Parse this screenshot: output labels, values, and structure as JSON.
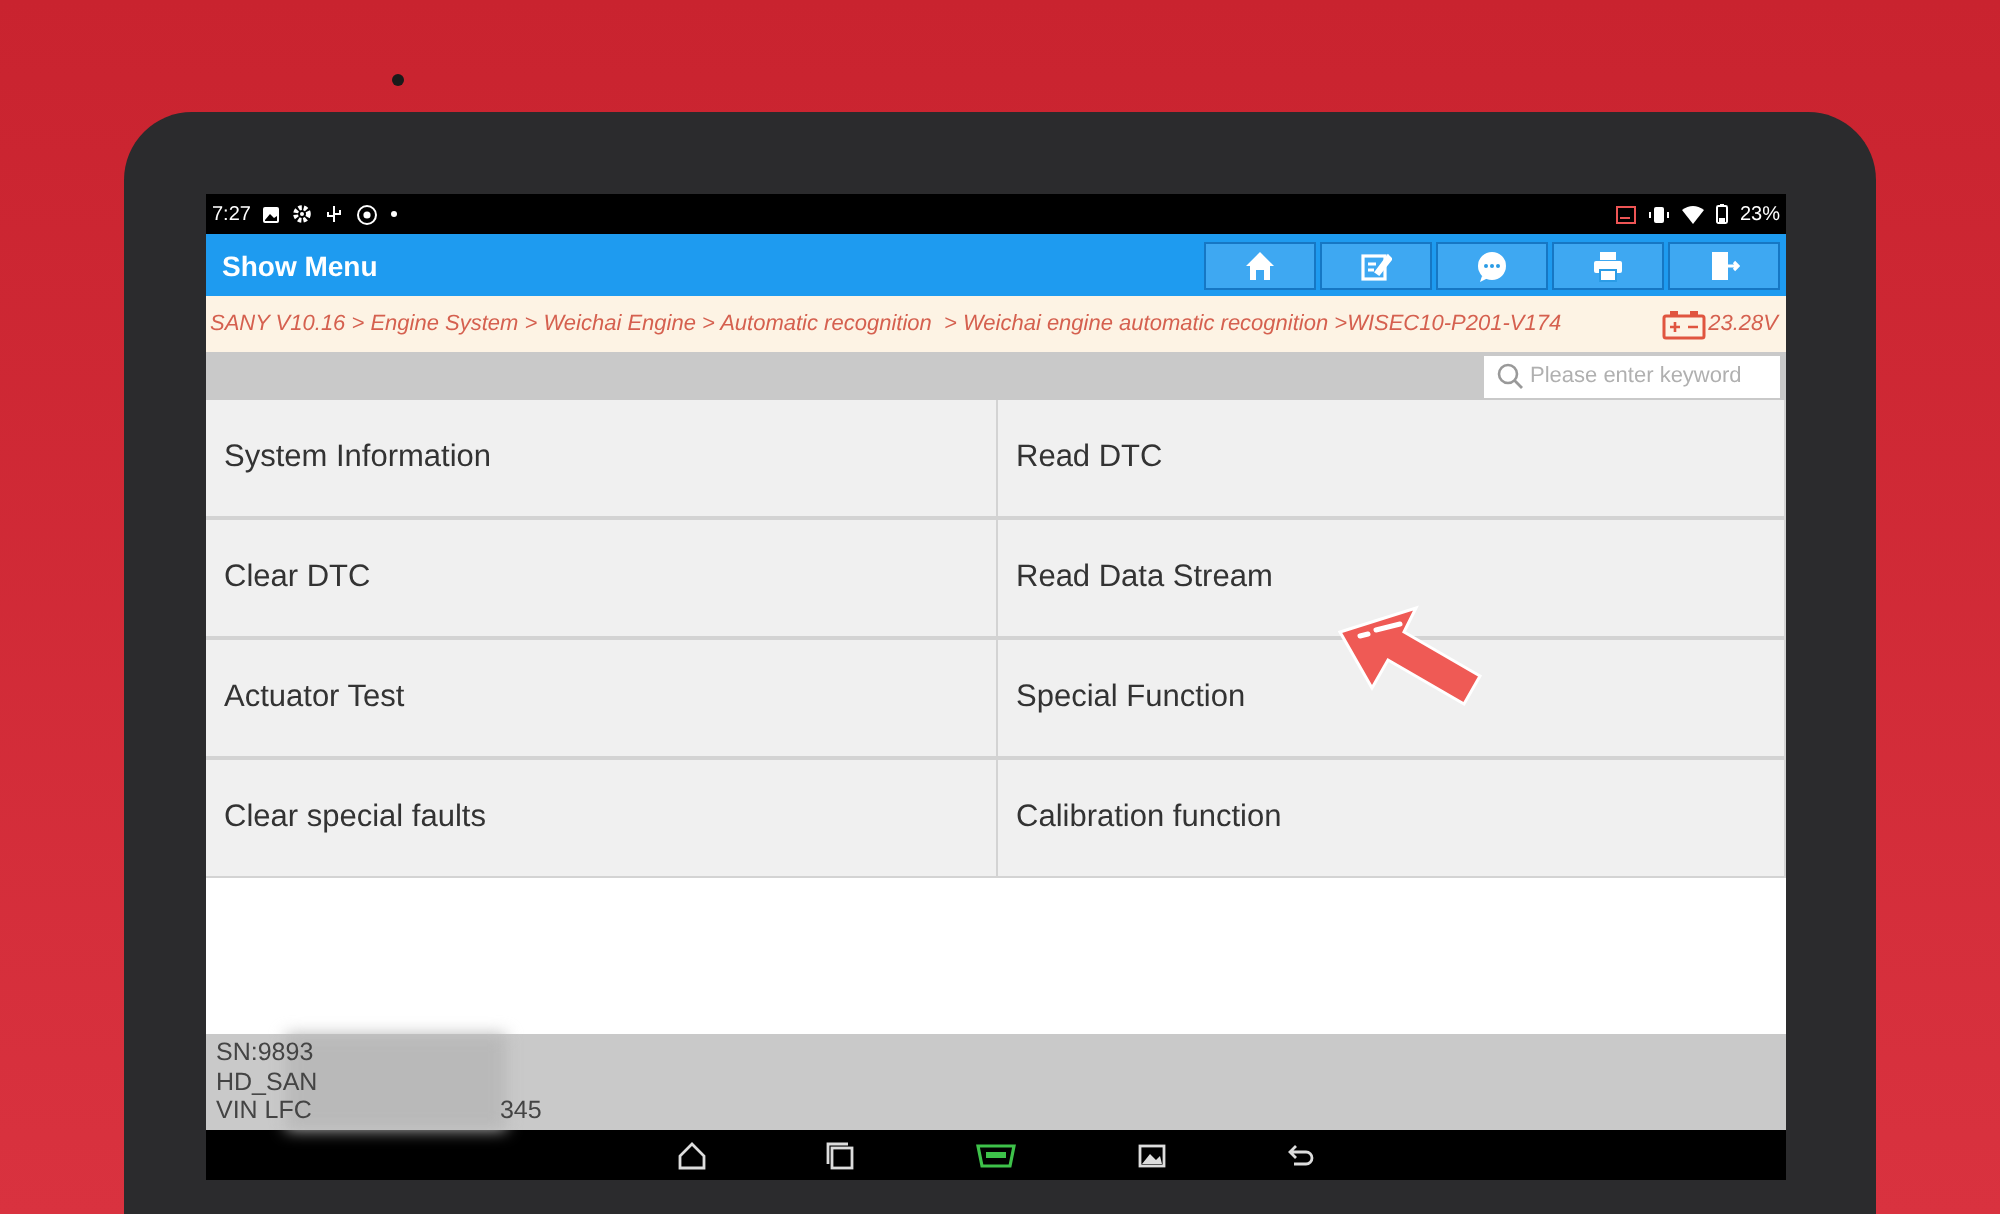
{
  "status_bar": {
    "time": "7:27",
    "battery": "23%"
  },
  "title": "Show Menu",
  "breadcrumb": {
    "path": "SANY V10.16 > Engine System > Weichai Engine > Automatic recognition  > Weichai engine automatic recognition >WISEC10-P201-V174",
    "voltage": "23.28V"
  },
  "search": {
    "placeholder": "Please enter keyword"
  },
  "menu_items": [
    {
      "label": "System Information"
    },
    {
      "label": "Read DTC"
    },
    {
      "label": "Clear DTC"
    },
    {
      "label": "Read Data Stream"
    },
    {
      "label": "Actuator Test"
    },
    {
      "label": "Special Function"
    },
    {
      "label": "Clear special faults"
    },
    {
      "label": "Calibration function"
    }
  ],
  "vehicle_info": [
    [
      "SN:9893"
    ],
    [
      "HD_SAN"
    ],
    [
      "VIN LFC",
      "345"
    ]
  ]
}
